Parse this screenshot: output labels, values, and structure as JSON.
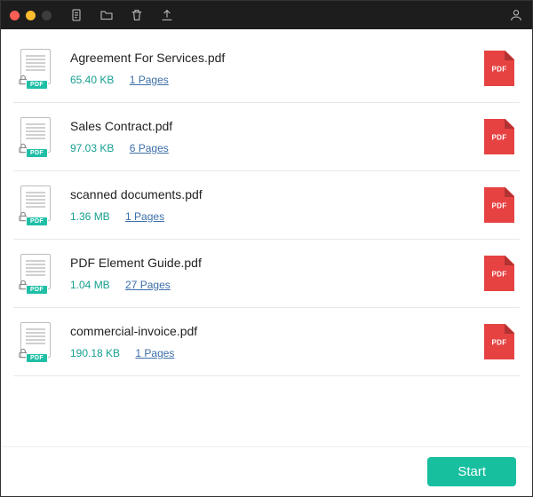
{
  "colors": {
    "accent": "#18bf9f",
    "danger": "#e74242",
    "link": "#3b6ea8"
  },
  "titlebar": {
    "icons": [
      "document",
      "folder",
      "trash",
      "upload"
    ],
    "right_icon": "user"
  },
  "files": [
    {
      "name": "Agreement For Services.pdf",
      "size": "65.40 KB",
      "pages_label": "1 Pages",
      "badge": "PDF"
    },
    {
      "name": "Sales Contract.pdf",
      "size": "97.03 KB",
      "pages_label": "6 Pages",
      "badge": "PDF"
    },
    {
      "name": "scanned documents.pdf",
      "size": "1.36 MB",
      "pages_label": "1 Pages",
      "badge": "PDF"
    },
    {
      "name": "PDF Element Guide.pdf",
      "size": "1.04 MB",
      "pages_label": "27 Pages",
      "badge": "PDF"
    },
    {
      "name": "commercial-invoice.pdf",
      "size": "190.18 KB",
      "pages_label": "1 Pages",
      "badge": "PDF"
    }
  ],
  "pdf_tile_label": "PDF",
  "thumb_badge": "PDF",
  "footer": {
    "start_label": "Start"
  }
}
